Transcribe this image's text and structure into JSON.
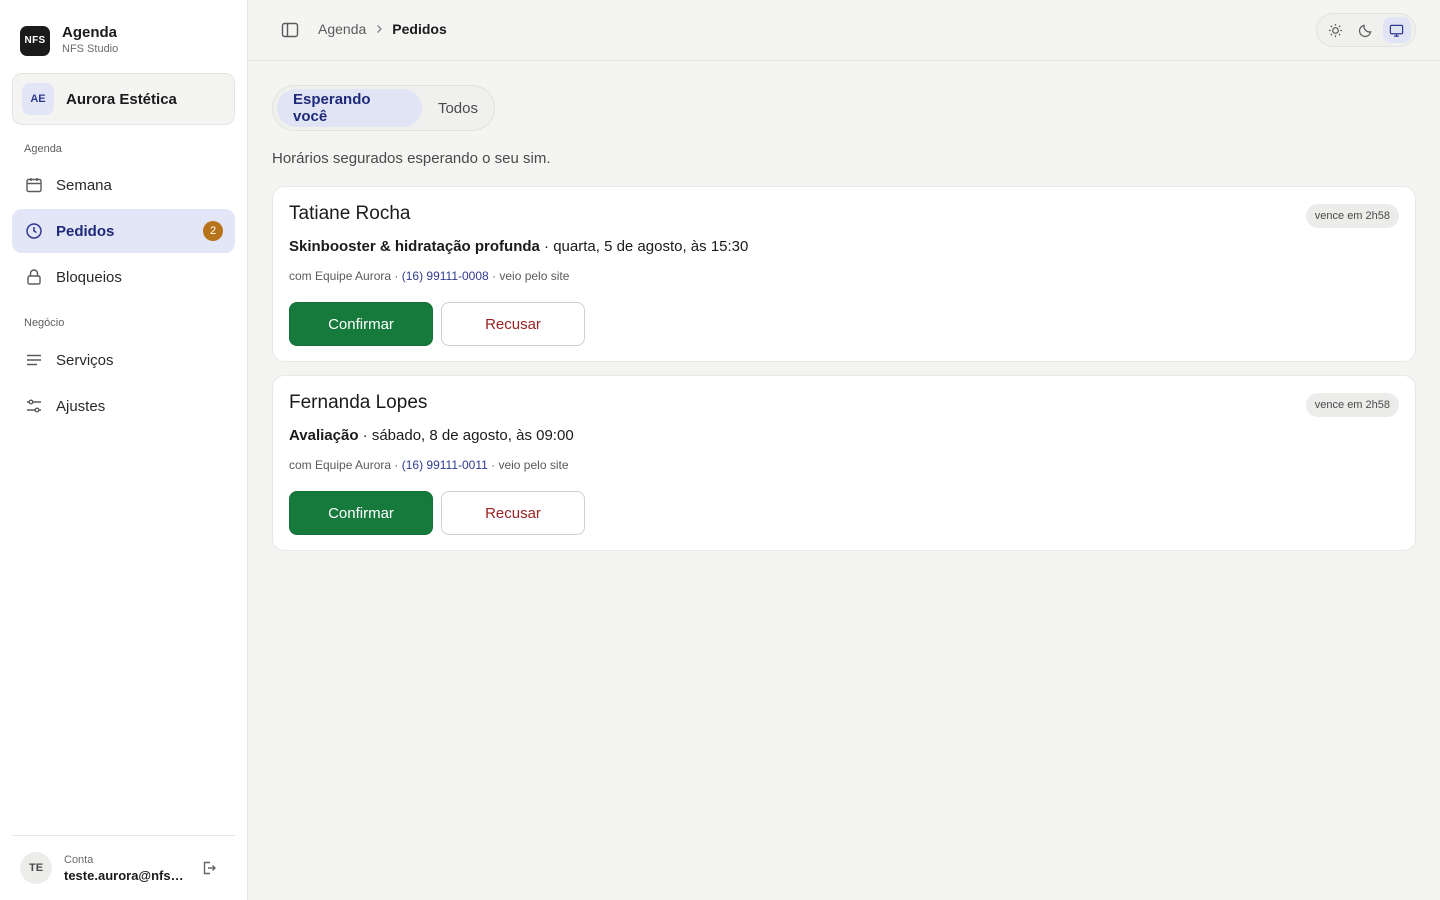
{
  "brand": {
    "logo_text": "NFS",
    "title": "Agenda",
    "subtitle": "NFS Studio"
  },
  "business": {
    "initials": "AE",
    "name": "Aurora Estética"
  },
  "sidebar": {
    "sections": [
      {
        "label": "Agenda"
      },
      {
        "label": "Negócio"
      }
    ],
    "items": [
      {
        "label": "Semana",
        "icon": "calendar-icon"
      },
      {
        "label": "Pedidos",
        "icon": "clock-icon",
        "badge": "2",
        "active": true
      },
      {
        "label": "Bloqueios",
        "icon": "lock-icon"
      },
      {
        "label": "Serviços",
        "icon": "list-icon"
      },
      {
        "label": "Ajustes",
        "icon": "sliders-icon"
      }
    ]
  },
  "account": {
    "initials": "TE",
    "label": "Conta",
    "email": "teste.aurora@nfss..."
  },
  "topbar": {
    "breadcrumb": {
      "root": "Agenda",
      "current": "Pedidos"
    },
    "theme_options": [
      "sun-icon",
      "moon-icon",
      "monitor-icon"
    ],
    "theme_selected": "monitor-icon"
  },
  "tabs": [
    {
      "label": "Esperando você",
      "active": true
    },
    {
      "label": "Todos",
      "active": false
    }
  ],
  "subtitle": "Horários segurados esperando o seu sim.",
  "requests": [
    {
      "name": "Tatiane Rocha",
      "expiry": "vence em 2h58",
      "service": "Skinbooster & hidratação profunda",
      "when": " · quarta, 5 de agosto, às 15:30",
      "meta_prefix": "com Equipe Aurora · ",
      "phone": "(16) 99111-0008",
      "meta_suffix": " · veio pelo site",
      "confirm_label": "Confirmar",
      "refuse_label": "Recusar"
    },
    {
      "name": "Fernanda Lopes",
      "expiry": "vence em 2h58",
      "service": "Avaliação",
      "when": " · sábado, 8 de agosto, às 09:00",
      "meta_prefix": "com Equipe Aurora · ",
      "phone": "(16) 99111-0011",
      "meta_suffix": " · veio pelo site",
      "confirm_label": "Confirmar",
      "refuse_label": "Recusar"
    }
  ],
  "colors": {
    "accent": "#2f3a8f",
    "accent_bg": "#e3e6f7",
    "confirm": "#167a3d",
    "refuse_text": "#9a2222",
    "badge": "#b8741a"
  }
}
